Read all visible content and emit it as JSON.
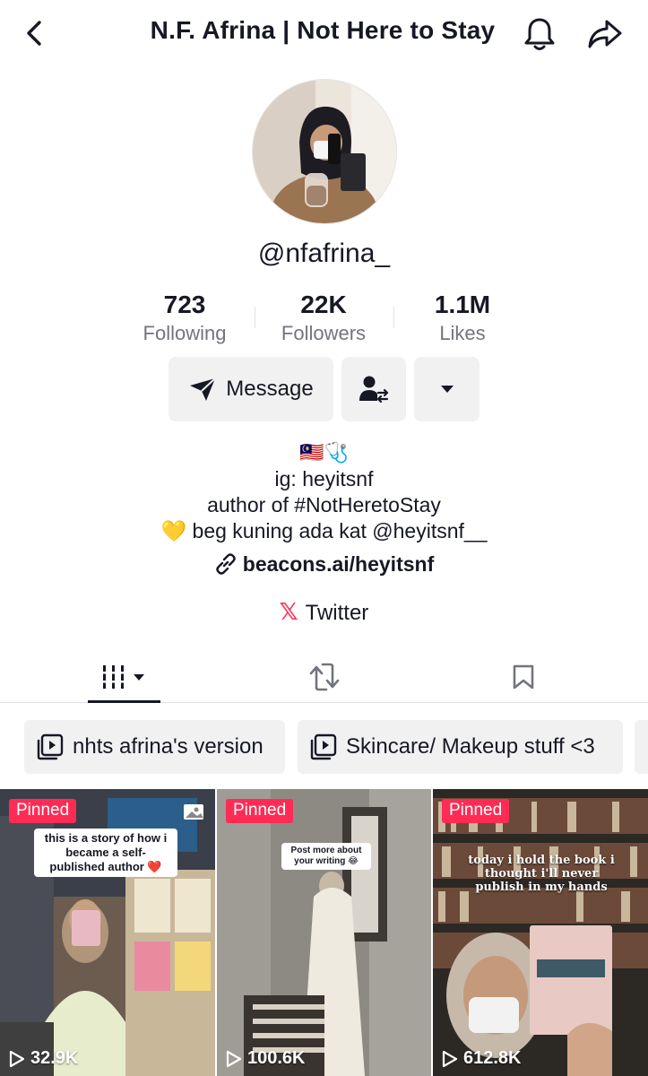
{
  "header": {
    "title": "N.F. Afrina | Not Here to Stay",
    "back_icon": "back-chevron-icon",
    "bell_icon": "bell-icon",
    "share_icon": "share-arrow-icon"
  },
  "profile": {
    "username": "@nfafrina_",
    "stats": [
      {
        "value": "723",
        "label": "Following"
      },
      {
        "value": "22K",
        "label": "Followers"
      },
      {
        "value": "1.1M",
        "label": "Likes"
      }
    ],
    "message_label": "Message",
    "bio": {
      "emoji_line": "🇲🇾🩺",
      "lines": [
        "ig: heyitsnf",
        "author of #NotHeretoStay",
        "💛 beg kuning ada kat @heyitsnf__"
      ],
      "link": "beacons.ai/heyitsnf",
      "twitter_label": "Twitter",
      "twitter_mark": "𝕏"
    }
  },
  "tabs": [
    "videos-tab",
    "reposts-tab",
    "favorites-tab"
  ],
  "playlists": [
    {
      "label": "nhts afrina's version"
    },
    {
      "label": "Skincare/ Makeup stuff <3"
    }
  ],
  "videos": [
    {
      "pinned": "Pinned",
      "views": "32.9K",
      "caption": "this is a story of how i became a self-published author ❤️"
    },
    {
      "pinned": "Pinned",
      "views": "100.6K",
      "caption": "Post more about your writing 😂"
    },
    {
      "pinned": "Pinned",
      "views": "612.8K",
      "caption": "today i hold the book i thought i'll never publish in my hands"
    }
  ],
  "colors": {
    "accent": "#fe2c55",
    "text": "#161823",
    "muted": "#73757c",
    "button_bg": "#f1f1f2"
  }
}
